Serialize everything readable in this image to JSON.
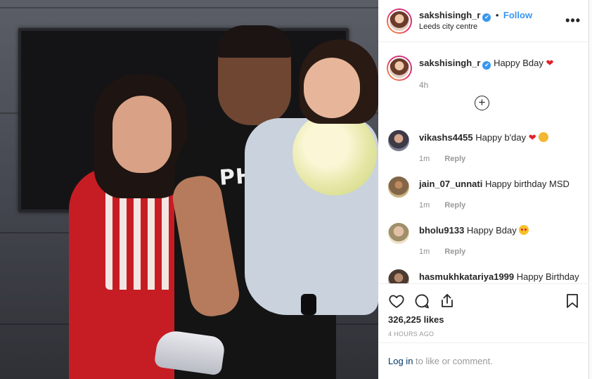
{
  "post": {
    "username": "sakshisingh_r",
    "verified_mark": "✔",
    "separator": "•",
    "follow_label": "Follow",
    "location": "Leeds city centre",
    "more_label": "•••",
    "photo_shirt_text": "PHILIP"
  },
  "caption": {
    "username": "sakshisingh_r",
    "text": "Happy Bday",
    "emoji": "❤",
    "time": "4h",
    "load_more_label": "+"
  },
  "comments": [
    {
      "username": "vikashs4455",
      "text": "Happy b'day",
      "emoji": "❤",
      "time": "1m",
      "reply_label": "Reply"
    },
    {
      "username": "jain_07_unnati",
      "text": "Happy birthday MSD",
      "time": "1m",
      "reply_label": "Reply"
    },
    {
      "username": "bholu9133",
      "text": "Happy Bday",
      "time": "1m",
      "reply_label": "Reply"
    },
    {
      "username": "hasmukhkatariya1999",
      "text": "Happy Birthday"
    }
  ],
  "actions": {
    "icons": [
      "heart-icon",
      "comment-icon",
      "share-icon",
      "bookmark-icon"
    ],
    "likes": "326,225 likes",
    "posted_ago": "4 HOURS AGO"
  },
  "login": {
    "link_text": "Log in",
    "rest_text": " to like or comment."
  },
  "colors": {
    "accent": "#3897f0",
    "heart": "#e0202a",
    "text": "#262626",
    "muted": "#8e8e8e",
    "border": "#efefef"
  }
}
